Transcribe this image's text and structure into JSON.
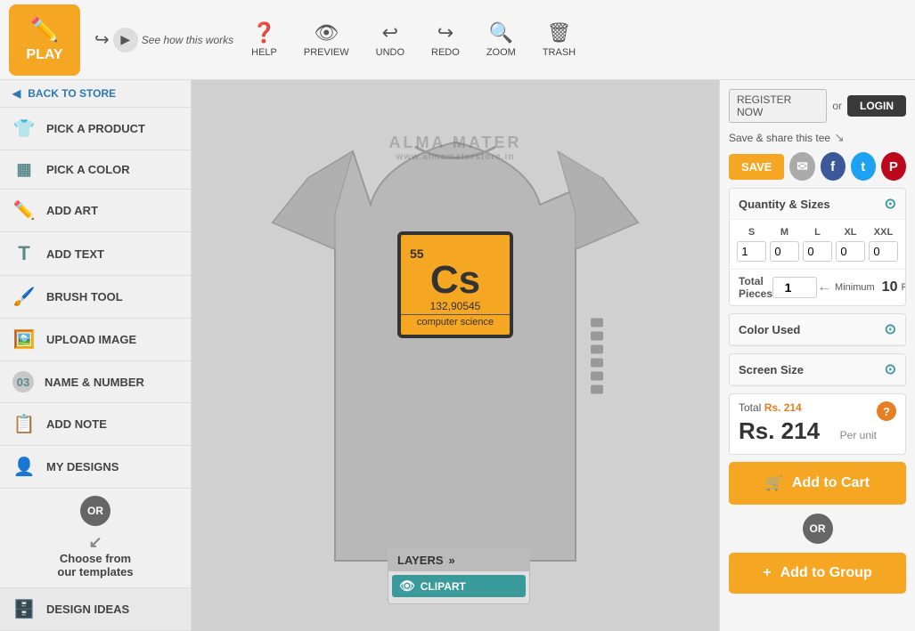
{
  "topbar": {
    "play_label": "PLAY",
    "how_it_works": "See how this works",
    "help_label": "HELP",
    "preview_label": "PREVIEW",
    "undo_label": "UNDO",
    "redo_label": "REDO",
    "zoom_label": "ZOOM",
    "trash_label": "TRASH"
  },
  "sidebar": {
    "back_label": "BACK TO STORE",
    "items": [
      {
        "id": "pick-product",
        "label": "PICK A PRODUCT",
        "icon": "👕"
      },
      {
        "id": "pick-color",
        "label": "PICK A COLOR",
        "icon": "🎨"
      },
      {
        "id": "add-art",
        "label": "ADD ART",
        "icon": "✏️"
      },
      {
        "id": "add-text",
        "label": "ADD TEXT",
        "icon": "T"
      },
      {
        "id": "brush-tool",
        "label": "BRUSH TOOL",
        "icon": "🖌️"
      },
      {
        "id": "upload-image",
        "label": "UPLOAD IMAGE",
        "icon": "🖼️"
      },
      {
        "id": "name-number",
        "label": "NAME & NUMBER",
        "icon": "03"
      },
      {
        "id": "add-note",
        "label": "ADD NOTE",
        "icon": "📝"
      },
      {
        "id": "my-designs",
        "label": "MY DESIGNS",
        "icon": "👤"
      }
    ],
    "or_label": "OR",
    "choose_templates": "Choose from\nour templates",
    "design_ideas": "DESIGN IDEAS"
  },
  "canvas": {
    "watermark_line1": "ALMA MATER",
    "watermark_line2": "www.almamaterstore.in",
    "layers_label": "LAYERS",
    "clipart_label": "CLIPART",
    "element": {
      "number": "55",
      "symbol": "Cs",
      "mass": "132,90545",
      "name": "computer science"
    }
  },
  "right_panel": {
    "register_label": "REGISTER NOW",
    "or_label": "or",
    "login_label": "LOGIN",
    "save_share_label": "Save & share this tee",
    "save_label": "SAVE",
    "quantity_sizes_label": "Quantity & Sizes",
    "sizes": [
      "S",
      "M",
      "L",
      "XL",
      "XXL"
    ],
    "size_values": [
      "1",
      "0",
      "0",
      "0",
      "0"
    ],
    "total_pieces_label": "Total\nPieces",
    "total_value": "1",
    "min_label": "Minimum",
    "min_value": "10",
    "pieces_label": "Pieces",
    "color_used_label": "Color Used",
    "screen_size_label": "Screen Size",
    "total_label": "Total",
    "total_price": "Rs. 214",
    "big_price": "Rs. 214",
    "per_unit_label": "Per unit",
    "add_to_cart_label": "Add to Cart",
    "or_label2": "OR",
    "add_to_group_label": "Add to Group"
  }
}
